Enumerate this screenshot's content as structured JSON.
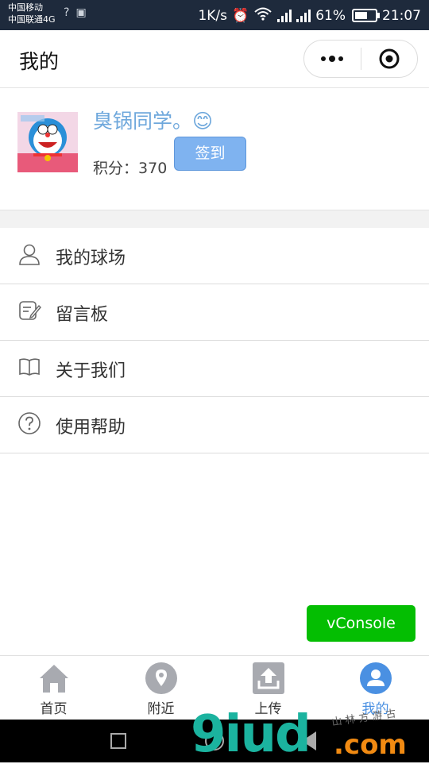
{
  "status_bar": {
    "carrier1": "中国移动",
    "carrier2": "中国联通4G",
    "speed": "1K/s",
    "battery": "61%",
    "battery_level": 0.61,
    "time": "21:07"
  },
  "nav": {
    "title": "我的"
  },
  "profile": {
    "username": "臭锅同学。😊",
    "points_label": "积分：",
    "points_value": "370",
    "signin_label": "签到"
  },
  "menu": [
    {
      "label": "我的球场",
      "icon": "person-icon"
    },
    {
      "label": "留言板",
      "icon": "note-edit-icon"
    },
    {
      "label": "关于我们",
      "icon": "book-icon"
    },
    {
      "label": "使用帮助",
      "icon": "question-circle-icon"
    }
  ],
  "vconsole": {
    "label": "vConsole"
  },
  "tabbar": [
    {
      "label": "首页",
      "icon": "home-icon",
      "active": false
    },
    {
      "label": "附近",
      "icon": "location-icon",
      "active": false
    },
    {
      "label": "上传",
      "icon": "upload-icon",
      "active": false
    },
    {
      "label": "我的",
      "icon": "user-icon",
      "active": true
    }
  ],
  "colors": {
    "accent": "#4a90e2",
    "username": "#6fa8dc",
    "signin_button": "#7fb3f0",
    "vconsole": "#04be02",
    "status_bar": "#1e2a3c"
  },
  "watermark": {
    "main": "9iud",
    "domain": ".com",
    "tagline": "山 林 方 游 古"
  }
}
